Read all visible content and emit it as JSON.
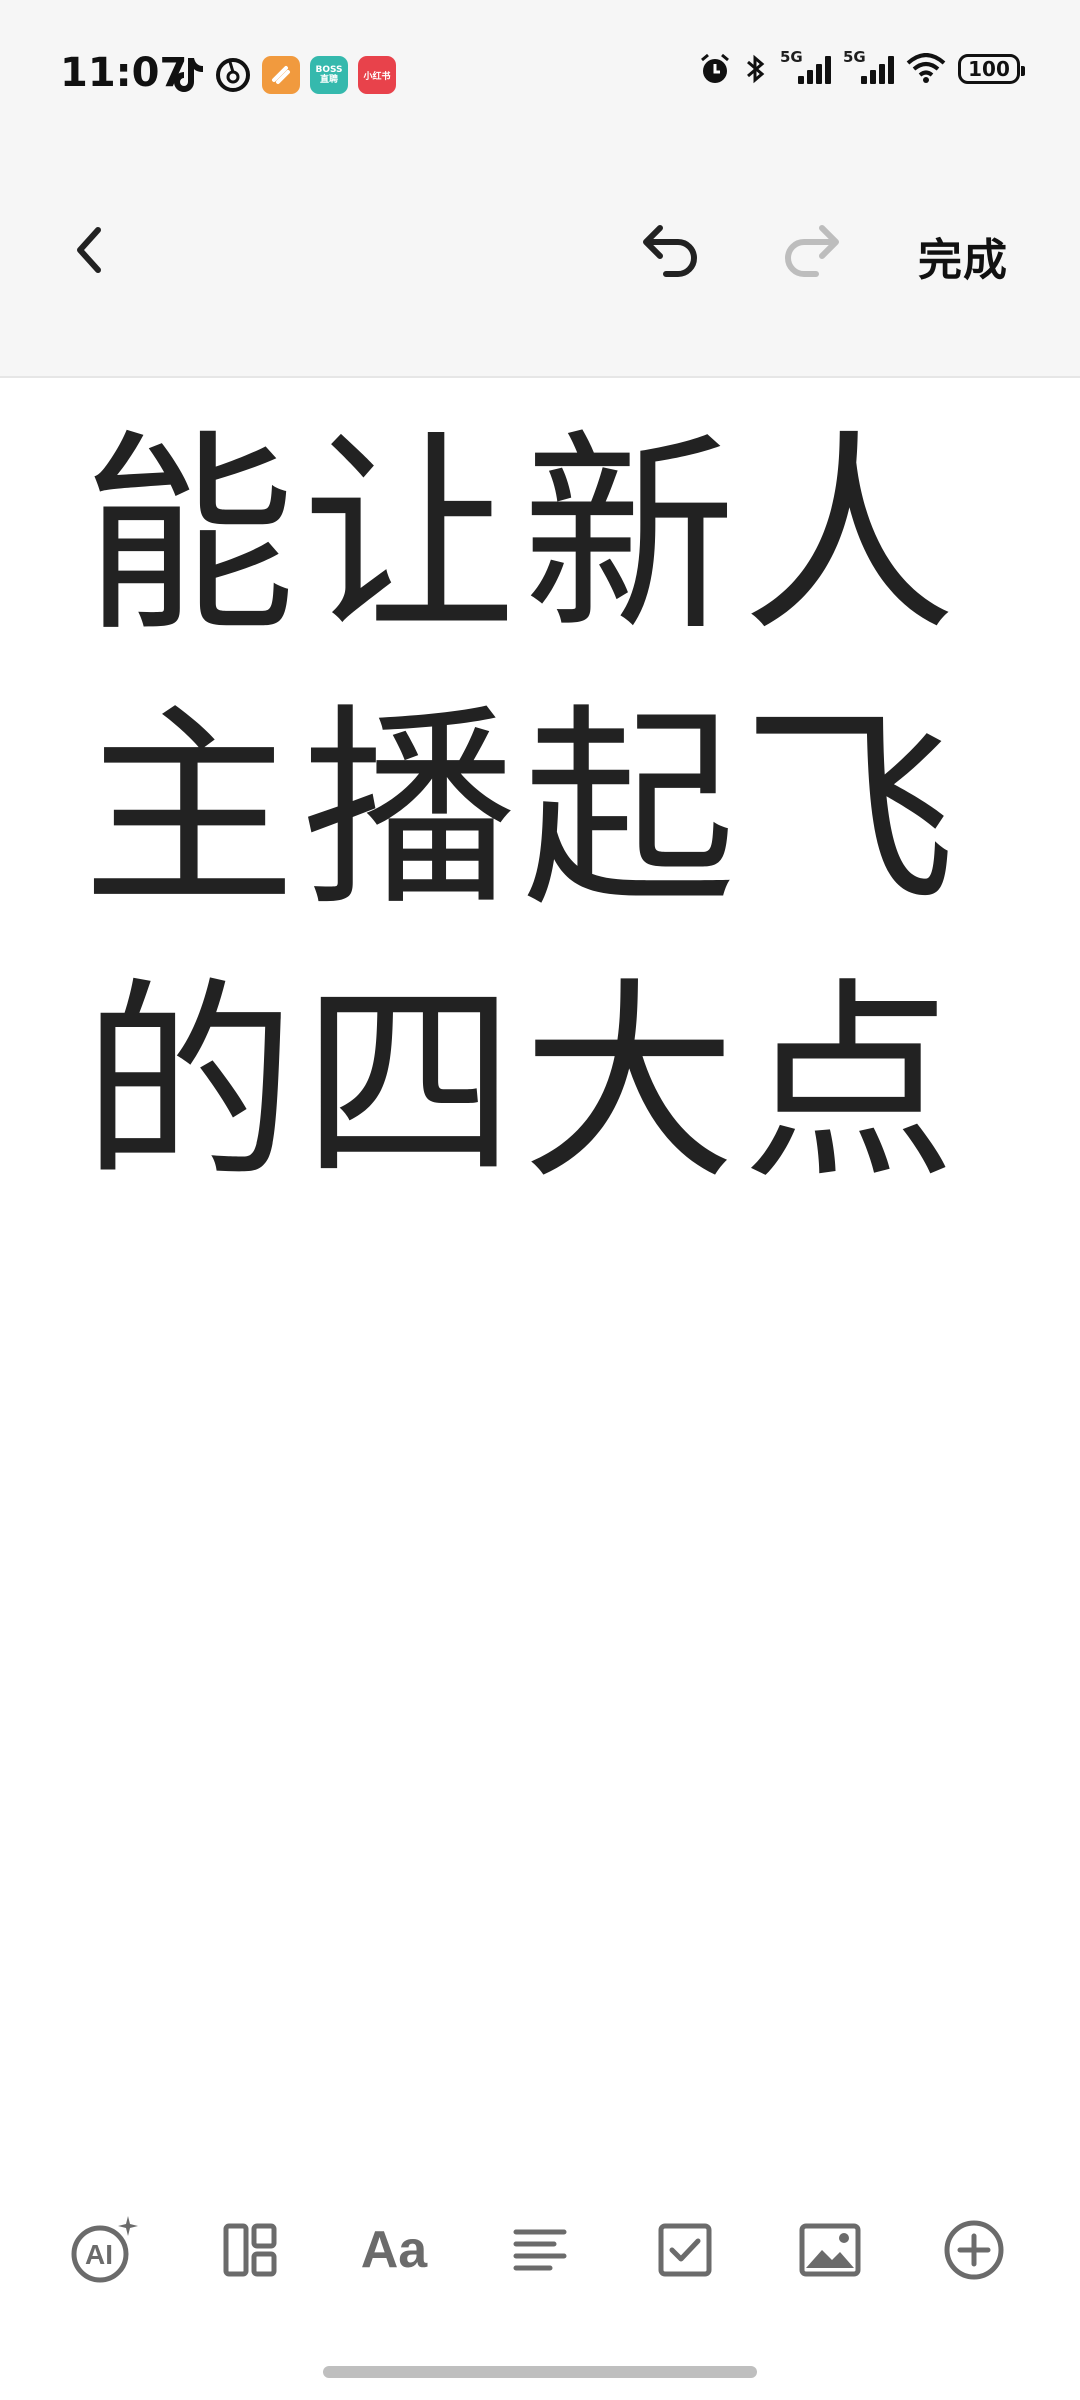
{
  "status_bar": {
    "time": "11:07",
    "app_badges": [
      {
        "name": "boss-app",
        "label": "BOSS\n直聘",
        "color": "#35b9ad"
      },
      {
        "name": "xiaohongshu-app",
        "label": "小红书",
        "color": "#e8424b"
      }
    ],
    "battery": "100",
    "network_label_1": "5G",
    "network_label_2": "5G"
  },
  "nav": {
    "done_label": "完成"
  },
  "editor": {
    "lines": [
      "能让新人",
      "主播起飞",
      "的四大点"
    ]
  },
  "toolbar": {
    "text_style_label": "Aa"
  },
  "colors": {
    "topbar_bg": "#f6f6f6",
    "icon_gray": "#6b6b6b",
    "text": "#222222"
  }
}
